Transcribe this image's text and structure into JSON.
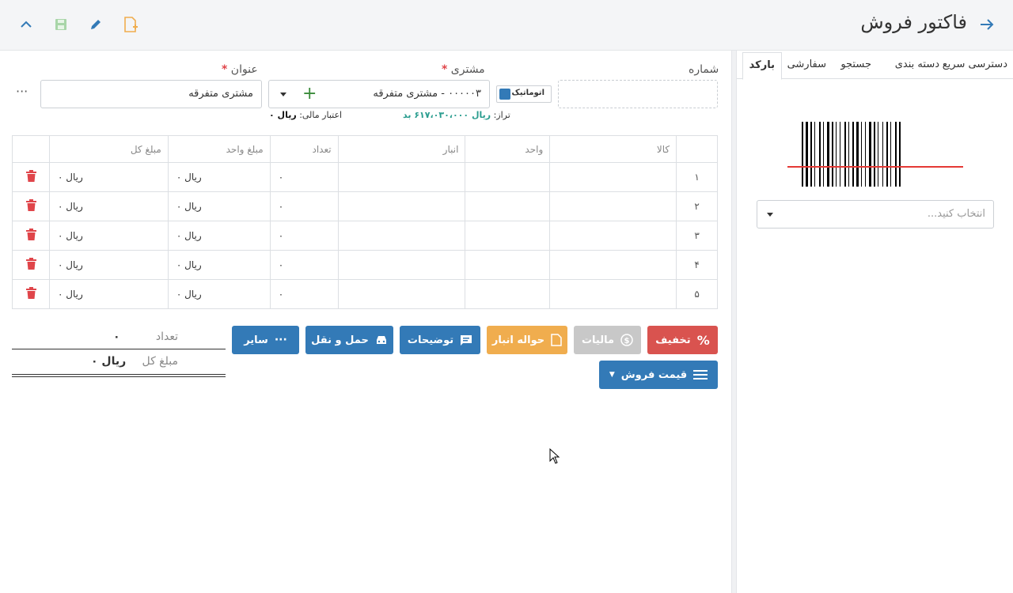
{
  "header": {
    "title": "فاکتور فروش"
  },
  "right_panel": {
    "tabs": [
      "بارکد",
      "سفارشی",
      "جستجو",
      "دسته بندی",
      "دسترسی سریع"
    ],
    "select_placeholder": "انتخاب کنید..."
  },
  "form": {
    "number_label": "شماره",
    "auto_label": "اتوماتیک",
    "customer_label": "مشتری",
    "customer_value": "۰۰۰۰۰۳ - مشتری متفرقه",
    "title_label": "عنوان",
    "title_value": "مشتری متفرقه",
    "balance_label": "تراز:",
    "balance_value": "ریال ۶۱۷،۰۳۰،۰۰۰ بد",
    "credit_label": "اعتبار مالی:",
    "credit_value": "ریال ۰",
    "more": "···"
  },
  "table": {
    "headers": [
      "کالا",
      "واحد",
      "انبار",
      "تعداد",
      "مبلغ واحد",
      "مبلغ کل"
    ],
    "rows": [
      {
        "no": "۱",
        "qty": "۰",
        "unit_price": "ریال ۰",
        "total": "ریال ۰"
      },
      {
        "no": "۲",
        "qty": "۰",
        "unit_price": "ریال ۰",
        "total": "ریال ۰"
      },
      {
        "no": "۳",
        "qty": "۰",
        "unit_price": "ریال ۰",
        "total": "ریال ۰"
      },
      {
        "no": "۴",
        "qty": "۰",
        "unit_price": "ریال ۰",
        "total": "ریال ۰"
      },
      {
        "no": "۵",
        "qty": "۰",
        "unit_price": "ریال ۰",
        "total": "ریال ۰"
      }
    ]
  },
  "actions": {
    "discount": "تخفیف",
    "tax": "مالیات",
    "warehouse": "حواله انبار",
    "notes": "توضیحات",
    "transport": "حمل و نقل",
    "other": "سایر",
    "price": "قیمت فروش"
  },
  "summary": {
    "count_label": "تعداد",
    "count_value": "۰",
    "total_label": "مبلغ کل",
    "total_value": "ریال ۰"
  },
  "colors": {
    "primary": "#337ab7",
    "danger": "#d9534f",
    "warning": "#f0ad4e",
    "disabled": "#c8c8c8",
    "success": "#3a8b3a",
    "accent": "#2a9d8f"
  }
}
